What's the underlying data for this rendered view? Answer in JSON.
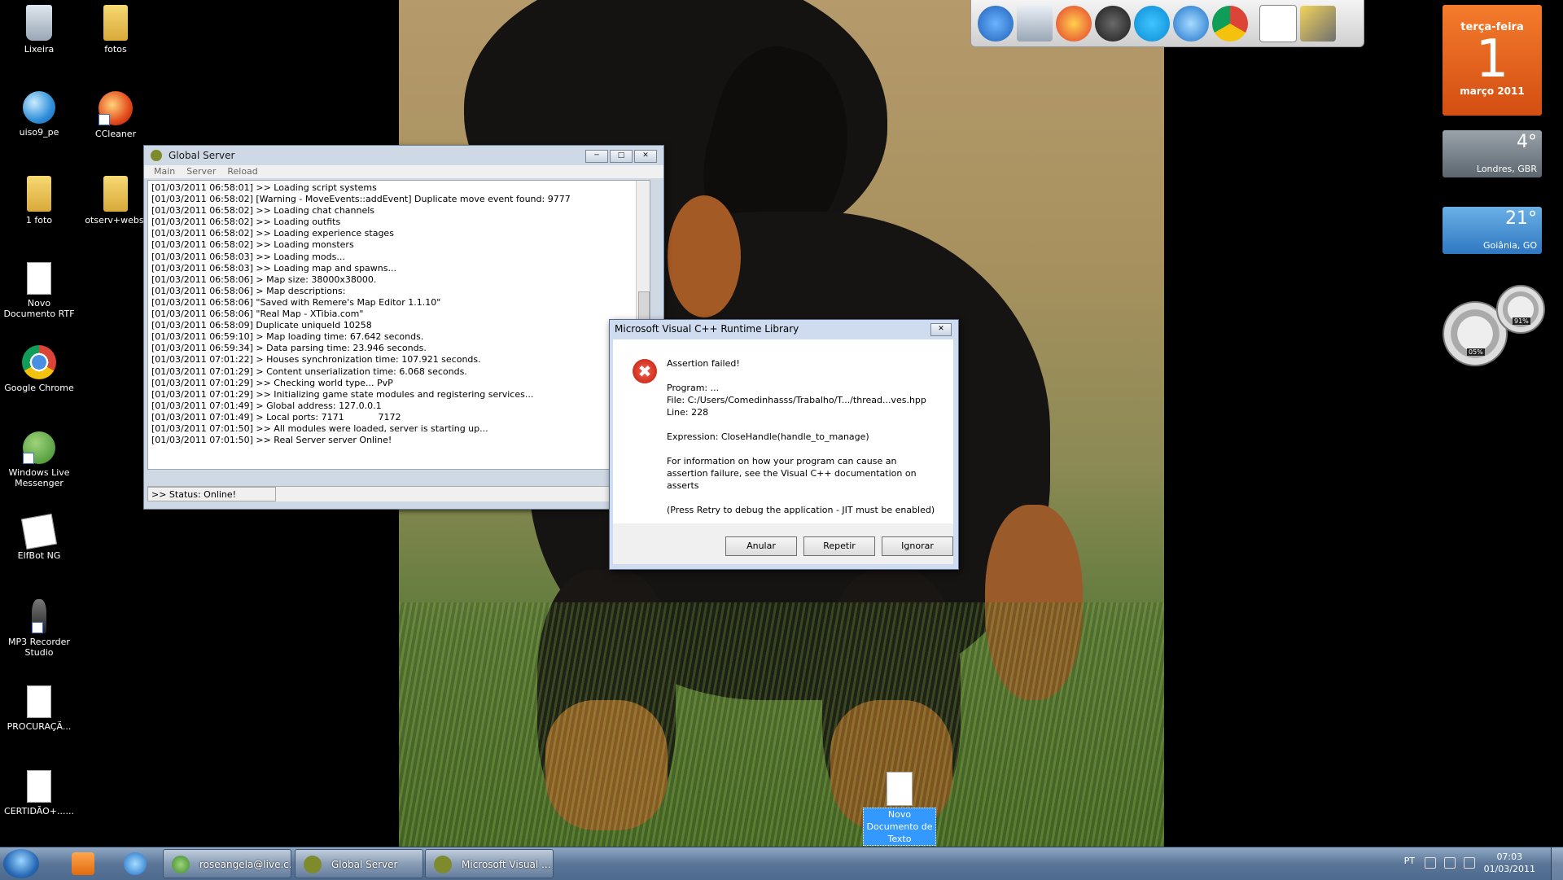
{
  "desktop_icons": [
    {
      "label": "Lixeira"
    },
    {
      "label": "fotos"
    },
    {
      "label": "uiso9_pe"
    },
    {
      "label": "CCleaner"
    },
    {
      "label": "1 foto"
    },
    {
      "label": "otserv+websi"
    },
    {
      "label": "Novo Documento RTF"
    },
    {
      "label": "Google Chrome"
    },
    {
      "label": "Windows Live Messenger"
    },
    {
      "label": "ElfBot NG"
    },
    {
      "label": "MP3 Recorder Studio"
    },
    {
      "label": "PROCURAÇÃ..."
    },
    {
      "label": "CERTIDÃO+......"
    }
  ],
  "desktop_file": {
    "label": "Novo Documento de Texto"
  },
  "calendar": {
    "weekday": "terça-feira",
    "day": "1",
    "month_year": "março 2011"
  },
  "weather": [
    {
      "temp": "4°",
      "city": "Londres, GBR"
    },
    {
      "temp": "21°",
      "city": "Goiânia, GO"
    }
  ],
  "meters": {
    "cpu": "05%",
    "mem": "91%"
  },
  "global_server": {
    "title": "Global  Server",
    "menu": [
      "Main",
      "Server",
      "Reload"
    ],
    "log": "[01/03/2011 06:58:01] >> Loading script systems\n[01/03/2011 06:58:02] [Warning - MoveEvents::addEvent] Duplicate move event found: 9777\n[01/03/2011 06:58:02] >> Loading chat channels\n[01/03/2011 06:58:02] >> Loading outfits\n[01/03/2011 06:58:02] >> Loading experience stages\n[01/03/2011 06:58:02] >> Loading monsters\n[01/03/2011 06:58:03] >> Loading mods...\n[01/03/2011 06:58:03] >> Loading map and spawns...\n[01/03/2011 06:58:06] > Map size: 38000x38000.\n[01/03/2011 06:58:06] > Map descriptions:\n[01/03/2011 06:58:06] \"Saved with Remere's Map Editor 1.1.10\"\n[01/03/2011 06:58:06] \"Real Map - XTibia.com\"\n[01/03/2011 06:58:09] Duplicate uniqueId 10258\n[01/03/2011 06:59:10] > Map loading time: 67.642 seconds.\n[01/03/2011 06:59:34] > Data parsing time: 23.946 seconds.\n[01/03/2011 07:01:22] > Houses synchronization time: 107.921 seconds.\n[01/03/2011 07:01:29] > Content unserialization time: 6.068 seconds.\n[01/03/2011 07:01:29] >> Checking world type... PvP\n[01/03/2011 07:01:29] >> Initializing game state modules and registering services...\n[01/03/2011 07:01:49] > Global address: 127.0.0.1\n[01/03/2011 07:01:49] > Local ports: 7171            7172\n[01/03/2011 07:01:50] >> All modules were loaded, server is starting up...\n[01/03/2011 07:01:50] >> Real Server server Online!",
    "status": ">> Status: Online!"
  },
  "assert_dialog": {
    "title": "Microsoft Visual C++ Runtime Library",
    "heading": "Assertion failed!",
    "program": "Program: ...",
    "file": "File: C:/Users/Comedinhasss/Trabalho/T.../thread...ves.hpp",
    "line": "Line: 228",
    "expression": "Expression: CloseHandle(handle_to_manage)",
    "info": "For information on how your program can cause an assertion failure, see the Visual C++ documentation on asserts",
    "retry_note": "(Press Retry to debug the application - JIT must be enabled)",
    "buttons": {
      "abort": "Anular",
      "retry": "Repetir",
      "ignore": "Ignorar"
    }
  },
  "taskbar": {
    "tasks": [
      "roseangela@live.c...",
      "Global  Server",
      "Microsoft Visual ..."
    ],
    "lang": "PT",
    "time": "07:03",
    "date": "01/03/2011"
  }
}
